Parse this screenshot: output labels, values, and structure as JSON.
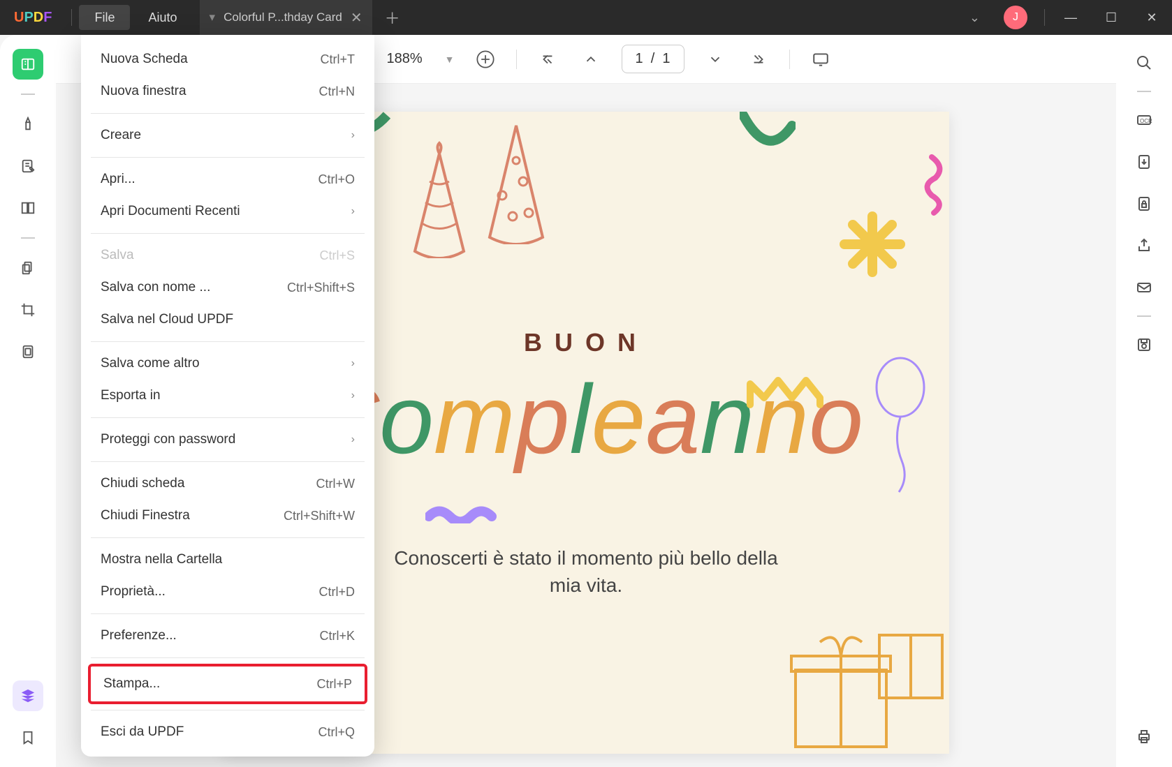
{
  "titlebar": {
    "logo": {
      "u": "U",
      "p": "P",
      "d": "D",
      "f": "F"
    },
    "menus": {
      "file": "File",
      "help": "Aiuto"
    },
    "tab_title": "Colorful P...thday Card",
    "avatar_initial": "J"
  },
  "toolbar": {
    "zoom": "188%",
    "page_current": "1",
    "page_sep": "/",
    "page_total": "1"
  },
  "card": {
    "line1": "BUON",
    "line2": "Compleanno",
    "message": "Conoscerti è stato il momento più bello della mia vita."
  },
  "file_menu": [
    {
      "type": "item",
      "label": "Nuova Scheda",
      "shortcut": "Ctrl+T"
    },
    {
      "type": "item",
      "label": "Nuova finestra",
      "shortcut": "Ctrl+N"
    },
    {
      "type": "sep"
    },
    {
      "type": "submenu",
      "label": "Creare"
    },
    {
      "type": "sep"
    },
    {
      "type": "item",
      "label": "Apri...",
      "shortcut": "Ctrl+O"
    },
    {
      "type": "submenu",
      "label": "Apri Documenti Recenti"
    },
    {
      "type": "sep"
    },
    {
      "type": "item",
      "label": "Salva",
      "shortcut": "Ctrl+S",
      "disabled": true
    },
    {
      "type": "item",
      "label": "Salva con nome ...",
      "shortcut": "Ctrl+Shift+S"
    },
    {
      "type": "item",
      "label": "Salva nel Cloud UPDF"
    },
    {
      "type": "sep"
    },
    {
      "type": "submenu",
      "label": "Salva come altro"
    },
    {
      "type": "submenu",
      "label": "Esporta in"
    },
    {
      "type": "sep"
    },
    {
      "type": "submenu",
      "label": "Proteggi con password"
    },
    {
      "type": "sep"
    },
    {
      "type": "item",
      "label": "Chiudi scheda",
      "shortcut": "Ctrl+W"
    },
    {
      "type": "item",
      "label": "Chiudi Finestra",
      "shortcut": "Ctrl+Shift+W"
    },
    {
      "type": "sep"
    },
    {
      "type": "item",
      "label": "Mostra nella Cartella"
    },
    {
      "type": "item",
      "label": "Proprietà...",
      "shortcut": "Ctrl+D"
    },
    {
      "type": "sep"
    },
    {
      "type": "item",
      "label": "Preferenze...",
      "shortcut": "Ctrl+K"
    },
    {
      "type": "sep"
    },
    {
      "type": "item",
      "label": "Stampa...",
      "shortcut": "Ctrl+P",
      "highlight": true
    },
    {
      "type": "sep"
    },
    {
      "type": "item",
      "label": "Esci da UPDF",
      "shortcut": "Ctrl+Q"
    }
  ]
}
